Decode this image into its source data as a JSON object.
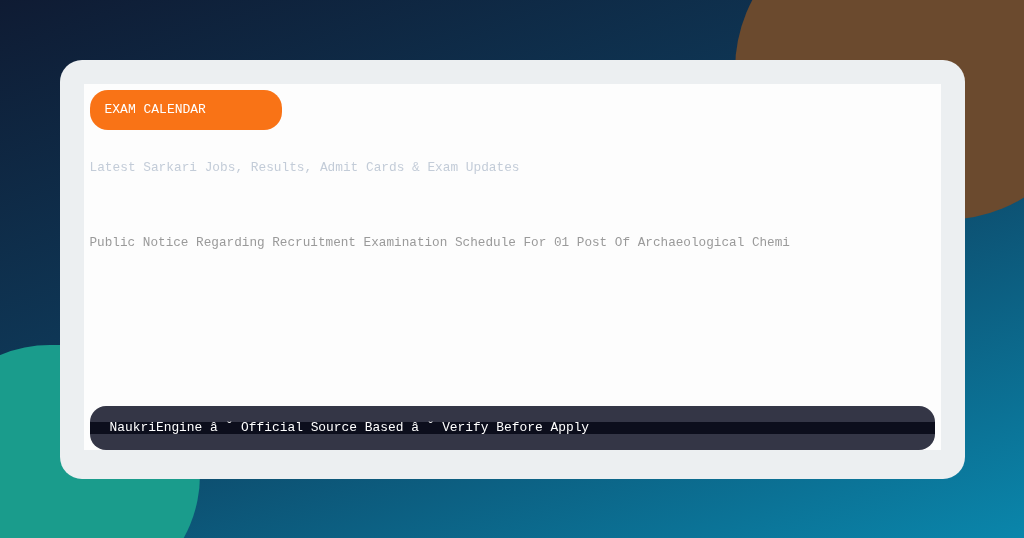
{
  "badge": {
    "label": "EXAM CALENDAR"
  },
  "tagline": "Latest Sarkari Jobs, Results, Admit Cards & Exam Updates",
  "headline": "Public Notice Regarding Recruitment Examination Schedule For 01 Post Of Archaeological Chemi",
  "footer": "NaukriEngine â ˘ Official Source Based â ˘ Verify Before Apply"
}
